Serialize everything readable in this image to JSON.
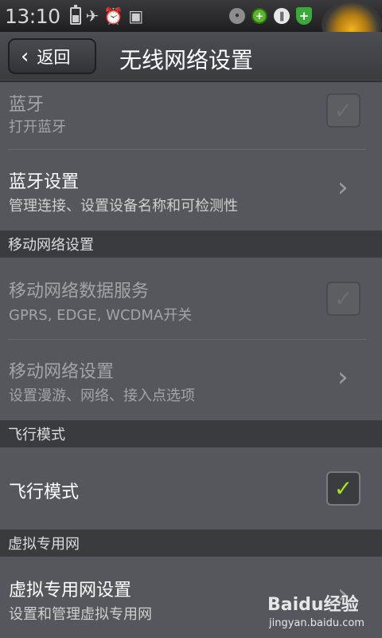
{
  "status_bar": {
    "time": "13:10",
    "icons": [
      "battery-icon",
      "airplane-icon",
      "alarm-icon",
      "sim-off-icon",
      "toggle-icon",
      "green-plus-icon",
      "pause-icon",
      "shield-icon"
    ]
  },
  "header": {
    "back_label": "返回",
    "title": "无线网络设置"
  },
  "items": [
    {
      "title": "蓝牙",
      "subtitle": "打开蓝牙",
      "control": "checkbox",
      "checked": false,
      "enabled": false
    },
    {
      "title": "蓝牙设置",
      "subtitle": "管理连接、设置设备名称和可检测性",
      "control": "arrow",
      "enabled": true
    }
  ],
  "sections": {
    "mobile": {
      "header": "移动网络设置",
      "items": [
        {
          "title": "移动网络数据服务",
          "subtitle": "GPRS, EDGE, WCDMA开关",
          "control": "checkbox",
          "checked": false,
          "enabled": false
        },
        {
          "title": "移动网络设置",
          "subtitle": "设置漫游、网络、接入点选项",
          "control": "arrow",
          "enabled": false
        }
      ]
    },
    "airplane": {
      "header": "飞行模式",
      "items": [
        {
          "title": "飞行模式",
          "control": "checkbox",
          "checked": true,
          "enabled": true
        }
      ]
    },
    "vpn": {
      "header": "虚拟专用网",
      "items": [
        {
          "title": "虚拟专用网设置",
          "subtitle": "设置和管理虚拟专用网",
          "control": "arrow",
          "enabled": true
        }
      ]
    }
  },
  "watermark": {
    "word": "Baidu经验",
    "site": "jingyan.baidu.com"
  },
  "colors": {
    "background": "#55575c",
    "section_header": "#3a3b3f",
    "check_green": "#a8e31b"
  }
}
